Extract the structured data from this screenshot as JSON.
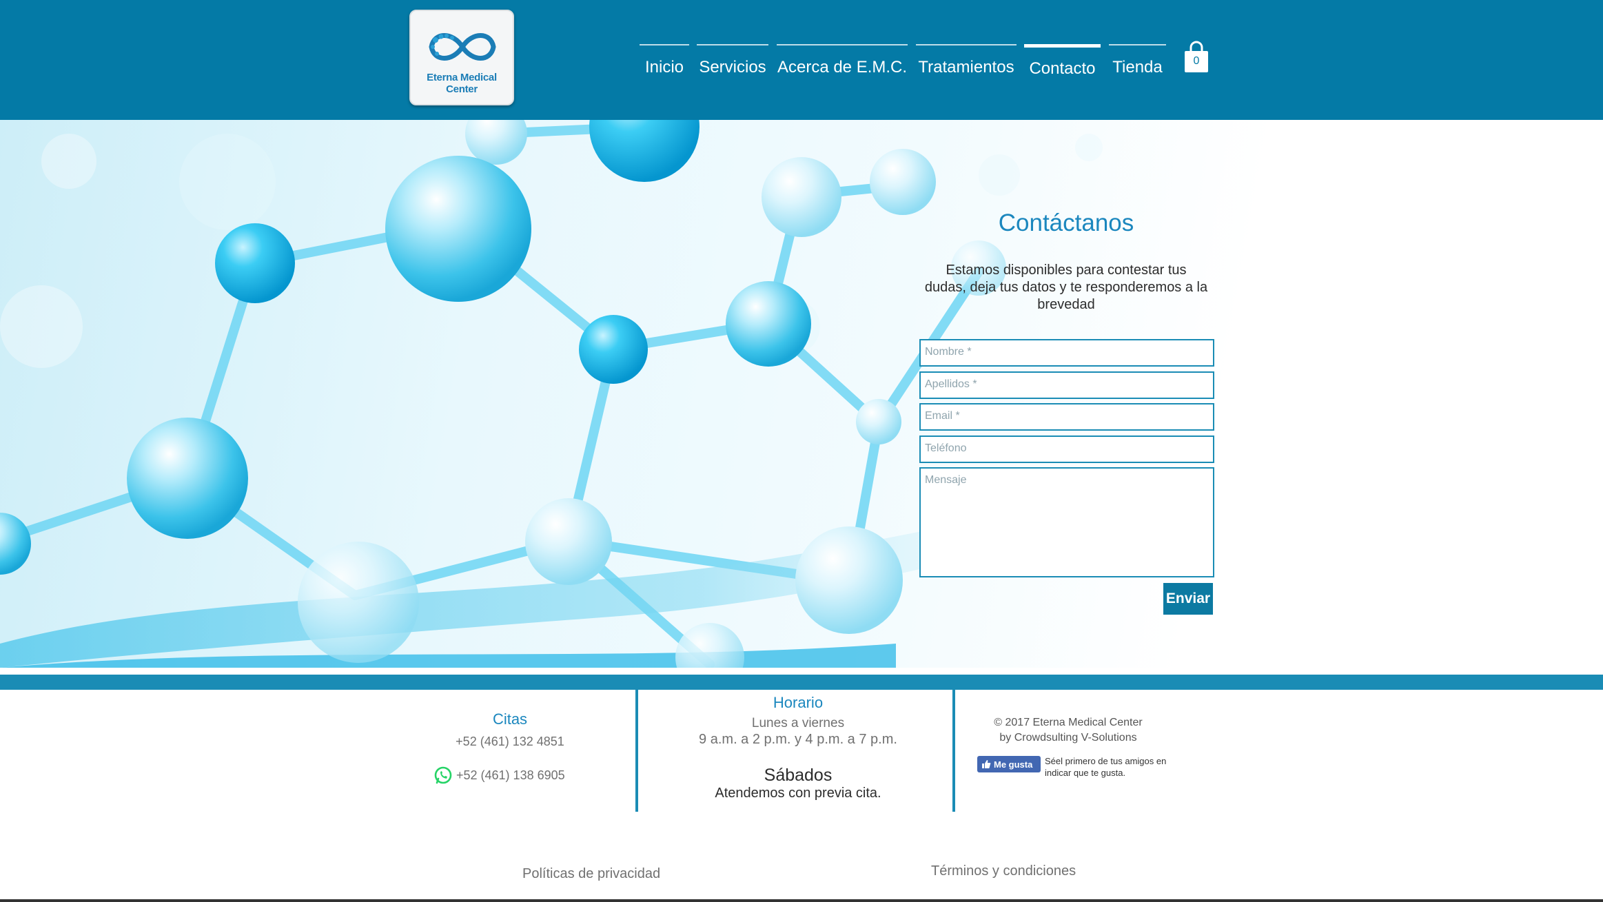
{
  "brand": {
    "logo_text": "Eterna Medical Center"
  },
  "nav": {
    "items": [
      {
        "label": "Inicio",
        "active": false
      },
      {
        "label": "Servicios",
        "active": false
      },
      {
        "label": "Acerca de E.M.C.",
        "active": false
      },
      {
        "label": "Tratamientos",
        "active": false
      },
      {
        "label": "Contacto",
        "active": true
      },
      {
        "label": "Tienda",
        "active": false
      }
    ],
    "cart_count": "0"
  },
  "contact_form": {
    "title": "Contáctanos",
    "description_line1": "Estamos disponibles para contestar tus",
    "description_line2": "dudas, deja tus datos y te responderemos a la",
    "description_line3": "brevedad",
    "fields": {
      "nombre": "Nombre *",
      "apellidos": "Apellidos *",
      "email": "Email *",
      "telefono": "Teléfono",
      "mensaje": "Mensaje"
    },
    "submit_label": "Enviar"
  },
  "footer": {
    "citas": {
      "title": "Citas",
      "phone1": "+52 (461) 132 4851",
      "phone2": "+52 (461) 138 6905"
    },
    "horario": {
      "title": "Horario",
      "weekdays": "Lunes a viernes",
      "weekday_hours": "9 a.m. a 2 p.m. y 4 p.m. a 7 p.m.",
      "saturday_title": "Sábados",
      "saturday_note": "Atendemos con previa cita."
    },
    "credits": {
      "copyright": "© 2017 Eterna Medical Center",
      "by": "by Crowdsulting V-Solutions"
    },
    "facebook": {
      "button_label": "Me gusta",
      "text": "Séel primero de tus amigos en indicar que te gusta."
    },
    "links": {
      "privacy": "Políticas de privacidad",
      "terms": "Términos y condiciones"
    }
  },
  "colors": {
    "header_bg": "#047aa6",
    "accent": "#1a8cb5",
    "title_blue": "#1b87be",
    "button_bg": "#0c7aa2",
    "facebook_blue": "#4267b2",
    "whatsapp_green": "#25d366"
  }
}
